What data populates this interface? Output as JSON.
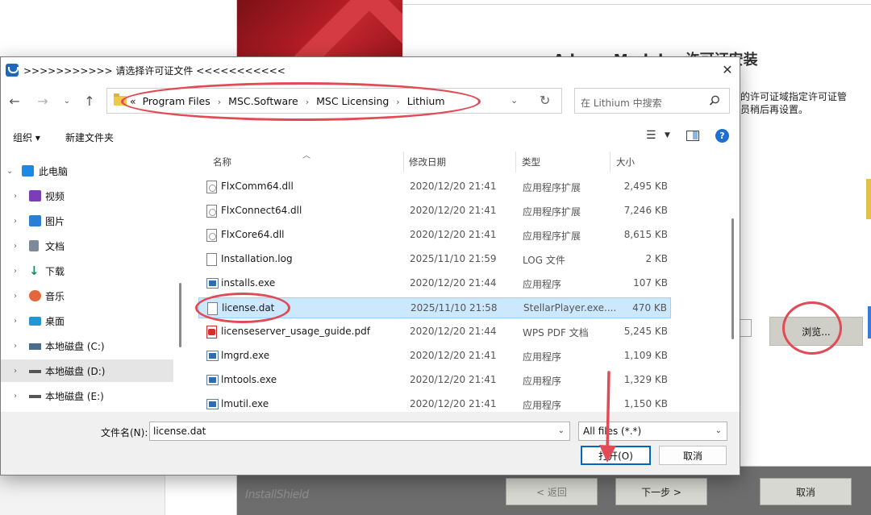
{
  "installer": {
    "title": "Adams Modeler 许可证安装",
    "desc_line1": "面的许可证域指定许可证管",
    "desc_line2": "理员稍后再设置。",
    "browse_label": "浏览...",
    "brand": "InstallShield",
    "back_label": "< 返回",
    "next_label": "下一步 >",
    "cancel_label": "取消"
  },
  "dialog": {
    "title": ">>>>>>>>>>> 请选择许可证文件 <<<<<<<<<<<",
    "close_label": "✕",
    "breadcrumb_prefix": "«",
    "breadcrumb": [
      "Program Files",
      "MSC.Software",
      "MSC Licensing",
      "Lithium"
    ],
    "breadcrumb_sep": "›",
    "search_placeholder": "在 Lithium 中搜索",
    "toolbar": {
      "organize": "组织 ▾",
      "new_folder": "新建文件夹",
      "help": "?"
    },
    "nav": [
      {
        "label": "此电脑",
        "icon": "monitor-icon",
        "color": "#1e88e5"
      },
      {
        "label": "视频",
        "icon": "video-icon",
        "color": "#7b3fb5"
      },
      {
        "label": "图片",
        "icon": "picture-icon",
        "color": "#2a7fd4"
      },
      {
        "label": "文档",
        "icon": "document-icon",
        "color": "#7d8a99"
      },
      {
        "label": "下载",
        "icon": "download-icon",
        "color": "#1a8f55"
      },
      {
        "label": "音乐",
        "icon": "music-icon",
        "color": "#e5663c"
      },
      {
        "label": "桌面",
        "icon": "desktop-icon",
        "color": "#2496d6"
      },
      {
        "label": "本地磁盘 (C:)",
        "icon": "drive-c-icon",
        "color": "#4a6c8f"
      },
      {
        "label": "本地磁盘 (D:)",
        "icon": "drive-icon",
        "color": "#555"
      },
      {
        "label": "本地磁盘 (E:)",
        "icon": "drive-icon",
        "color": "#555"
      }
    ],
    "columns": {
      "name": "名称",
      "date": "修改日期",
      "type": "类型",
      "size": "大小"
    },
    "files": [
      {
        "name": "FlxComm64.dll",
        "date": "2020/12/20 21:41",
        "type": "应用程序扩展",
        "size": "2,495 KB",
        "icon": "dll"
      },
      {
        "name": "FlxConnect64.dll",
        "date": "2020/12/20 21:41",
        "type": "应用程序扩展",
        "size": "7,246 KB",
        "icon": "dll"
      },
      {
        "name": "FlxCore64.dll",
        "date": "2020/12/20 21:41",
        "type": "应用程序扩展",
        "size": "8,615 KB",
        "icon": "dll"
      },
      {
        "name": "Installation.log",
        "date": "2025/11/10 21:59",
        "type": "LOG 文件",
        "size": "2 KB",
        "icon": "file"
      },
      {
        "name": "installs.exe",
        "date": "2020/12/20 21:44",
        "type": "应用程序",
        "size": "107 KB",
        "icon": "exe"
      },
      {
        "name": "license.dat",
        "date": "2025/11/10 21:58",
        "type": "StellarPlayer.exe....",
        "size": "470 KB",
        "icon": "file"
      },
      {
        "name": "licenseserver_usage_guide.pdf",
        "date": "2020/12/20 21:44",
        "type": "WPS PDF 文档",
        "size": "5,245 KB",
        "icon": "pdf"
      },
      {
        "name": "lmgrd.exe",
        "date": "2020/12/20 21:41",
        "type": "应用程序",
        "size": "1,109 KB",
        "icon": "exe"
      },
      {
        "name": "lmtools.exe",
        "date": "2020/12/20 21:41",
        "type": "应用程序",
        "size": "1,329 KB",
        "icon": "exe"
      },
      {
        "name": "lmutil.exe",
        "date": "2020/12/20 21:41",
        "type": "应用程序",
        "size": "1,150 KB",
        "icon": "exe"
      }
    ],
    "selected_index": 5,
    "filename_label": "文件名(N):",
    "filename_value": "license.dat",
    "filetype_value": "All files (*.*)",
    "open_label": "打开(O)",
    "cancel_label": "取消"
  },
  "annotation_color": "#e24a55"
}
